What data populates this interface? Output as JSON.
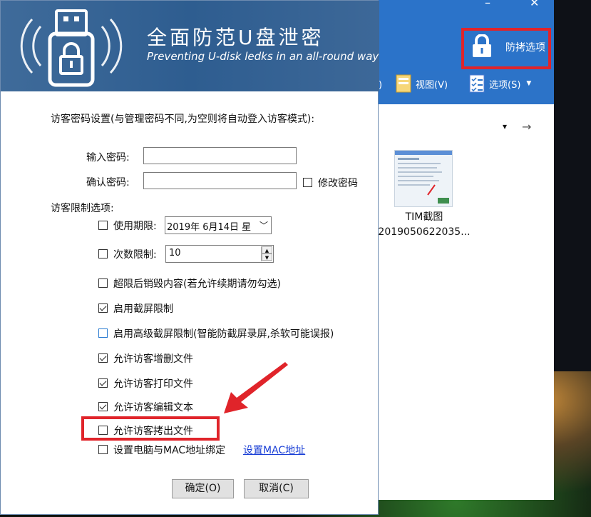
{
  "colors": {
    "banner": "#2e5d90",
    "highlight": "#e0242a",
    "link": "#1a3fd6",
    "explorer_blue": "#2b73c9"
  },
  "banner": {
    "title": "全面防范U盘泄密",
    "subtitle": "Preventing U-disk ledks in an all-round way",
    "icon": "usb-lock-icon"
  },
  "top_right": {
    "label": "防拷选项",
    "icon": "lock-icon"
  },
  "explorer": {
    "toolbar": {
      "view_label": "视图(V)",
      "options_label": "选项(S)",
      "left_fragment": ")"
    },
    "window_controls": {
      "minimize": "–",
      "close": "✕"
    },
    "nav": {
      "dropdown": "▾",
      "forward": "→"
    },
    "file": {
      "name_line1": "TIM截图",
      "name_line2": "2019050622035..."
    }
  },
  "dialog": {
    "header_text": "访客密码设置(与管理密码不同,为空则将自动登入访客模式):",
    "password_label": "输入密码:",
    "confirm_label": "确认密码:",
    "password_value": "",
    "confirm_value": "",
    "modify_password_label": "修改密码",
    "limits_heading": "访客限制选项:",
    "usage_period_label": "使用期限:",
    "usage_date_value": "2019年  6月14日  星",
    "count_limit_label": "次数限制:",
    "count_value": "10",
    "options": [
      {
        "label": "超限后销毁内容(若允许续期请勿勾选)",
        "checked": false
      },
      {
        "label": "启用截屏限制",
        "checked": true
      },
      {
        "label": "启用高级截屏限制(智能防截屏录屏,杀软可能误报)",
        "checked": false
      },
      {
        "label": "允许访客增删文件",
        "checked": true
      },
      {
        "label": "允许访客打印文件",
        "checked": true
      },
      {
        "label": "允许访客编辑文本",
        "checked": true
      },
      {
        "label": "允许访客拷出文件",
        "checked": false
      },
      {
        "label": "设置电脑与MAC地址绑定",
        "checked": false
      }
    ],
    "mac_link": "设置MAC地址",
    "ok_button": "确定(O)",
    "cancel_button": "取消(C)"
  }
}
